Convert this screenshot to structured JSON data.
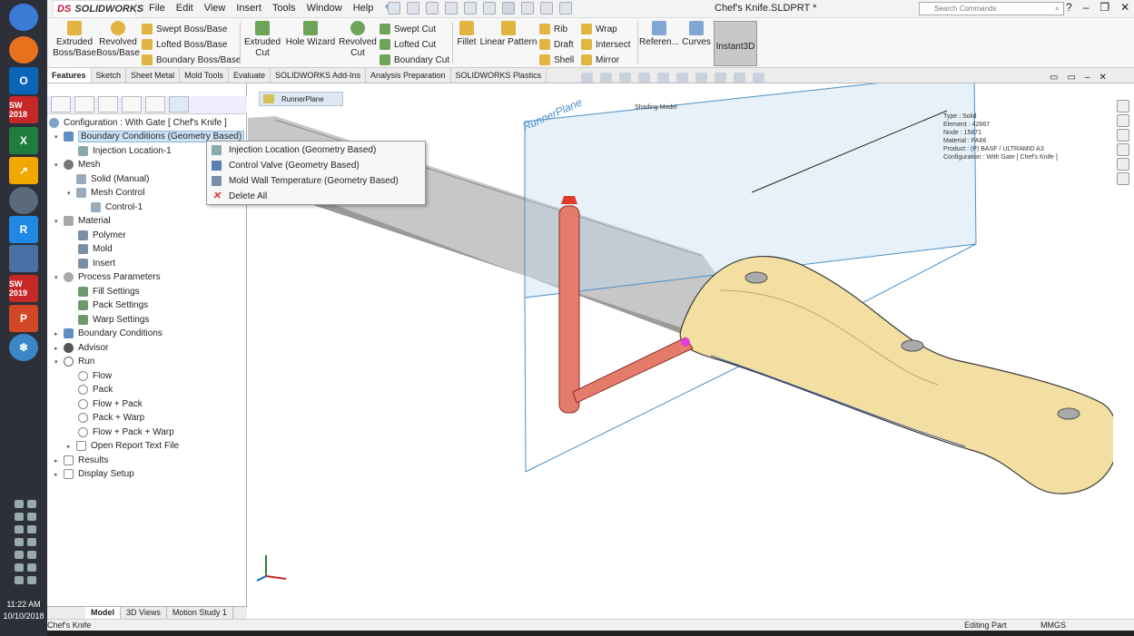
{
  "app": {
    "brand_ds": "DS",
    "brand": "SOLIDWORKS",
    "document_title": "Chef's Knife.SLDPRT *"
  },
  "menu": [
    "File",
    "Edit",
    "View",
    "Insert",
    "Tools",
    "Window",
    "Help"
  ],
  "search": {
    "placeholder": "Search Commands"
  },
  "window_controls": [
    "?",
    "–",
    "❐",
    "✕"
  ],
  "ribbon": {
    "extruded_boss": "Extruded Boss/Base",
    "revolved_boss": "Revolved Boss/Base",
    "swept_boss": "Swept Boss/Base",
    "lofted_boss": "Lofted Boss/Base",
    "boundary_boss": "Boundary Boss/Base",
    "extruded_cut": "Extruded Cut",
    "hole_wizard": "Hole Wizard",
    "revolved_cut": "Revolved Cut",
    "swept_cut": "Swept Cut",
    "lofted_cut": "Lofted Cut",
    "boundary_cut": "Boundary Cut",
    "fillet": "Fillet",
    "linear_pattern": "Linear Pattern",
    "rib": "Rib",
    "draft": "Draft",
    "shell": "Shell",
    "wrap": "Wrap",
    "intersect": "Intersect",
    "mirror": "Mirror",
    "reference": "Referen...",
    "curves": "Curves",
    "instant3d": "Instant3D"
  },
  "tabs": [
    "Features",
    "Sketch",
    "Sheet Metal",
    "Mold Tools",
    "Evaluate",
    "SOLIDWORKS Add-Ins",
    "Analysis Preparation",
    "SOLIDWORKS Plastics"
  ],
  "tree": {
    "config": "Configuration : With Gate [ Chef's Knife ]",
    "boundary_geo": "Boundary Conditions (Geometry Based)",
    "injection_location": "Injection Location-1",
    "mesh": "Mesh",
    "solid_manual": "Solid (Manual)",
    "mesh_control": "Mesh Control",
    "control1": "Control-1",
    "material": "Material",
    "polymer": "Polymer",
    "mold": "Mold",
    "insert": "Insert",
    "process_params": "Process Parameters",
    "fill_settings": "Fill Settings",
    "pack_settings": "Pack Settings",
    "warp_settings": "Warp Settings",
    "boundary": "Boundary Conditions",
    "advisor": "Advisor",
    "run": "Run",
    "flow": "Flow",
    "pack": "Pack",
    "flow_pack": "Flow + Pack",
    "pack_warp": "Pack + Warp",
    "flow_pack_warp": "Flow + Pack + Warp",
    "open_report": "Open Report Text File",
    "results": "Results",
    "display_setup": "Display Setup"
  },
  "context_menu": [
    "Injection Location (Geometry Based)",
    "Control Valve (Geometry Based)",
    "Mold Wall Temperature (Geometry Based)",
    "Delete All"
  ],
  "viewport": {
    "runner_plane_tab": "RunnerPlane",
    "plane_label": "RunnerPlane",
    "shading_label": "Shading Model",
    "info": [
      "Type : Solid",
      "Element : 42867",
      "Node : 15871",
      "Material : PA66",
      "Product : (P) BASF / ULTRAMID A3",
      "Configuration : With Gate [ Chef's Knife ]"
    ]
  },
  "bottom_tabs": [
    "Model",
    "3D Views",
    "Motion Study 1"
  ],
  "status": {
    "doc": "Chef's Knife",
    "mode": "Editing Part",
    "units": "MMGS"
  },
  "clock": {
    "time": "11:22 AM",
    "date": "10/10/2018"
  },
  "taskbar": [
    "SW 2018",
    "SW 2019"
  ]
}
